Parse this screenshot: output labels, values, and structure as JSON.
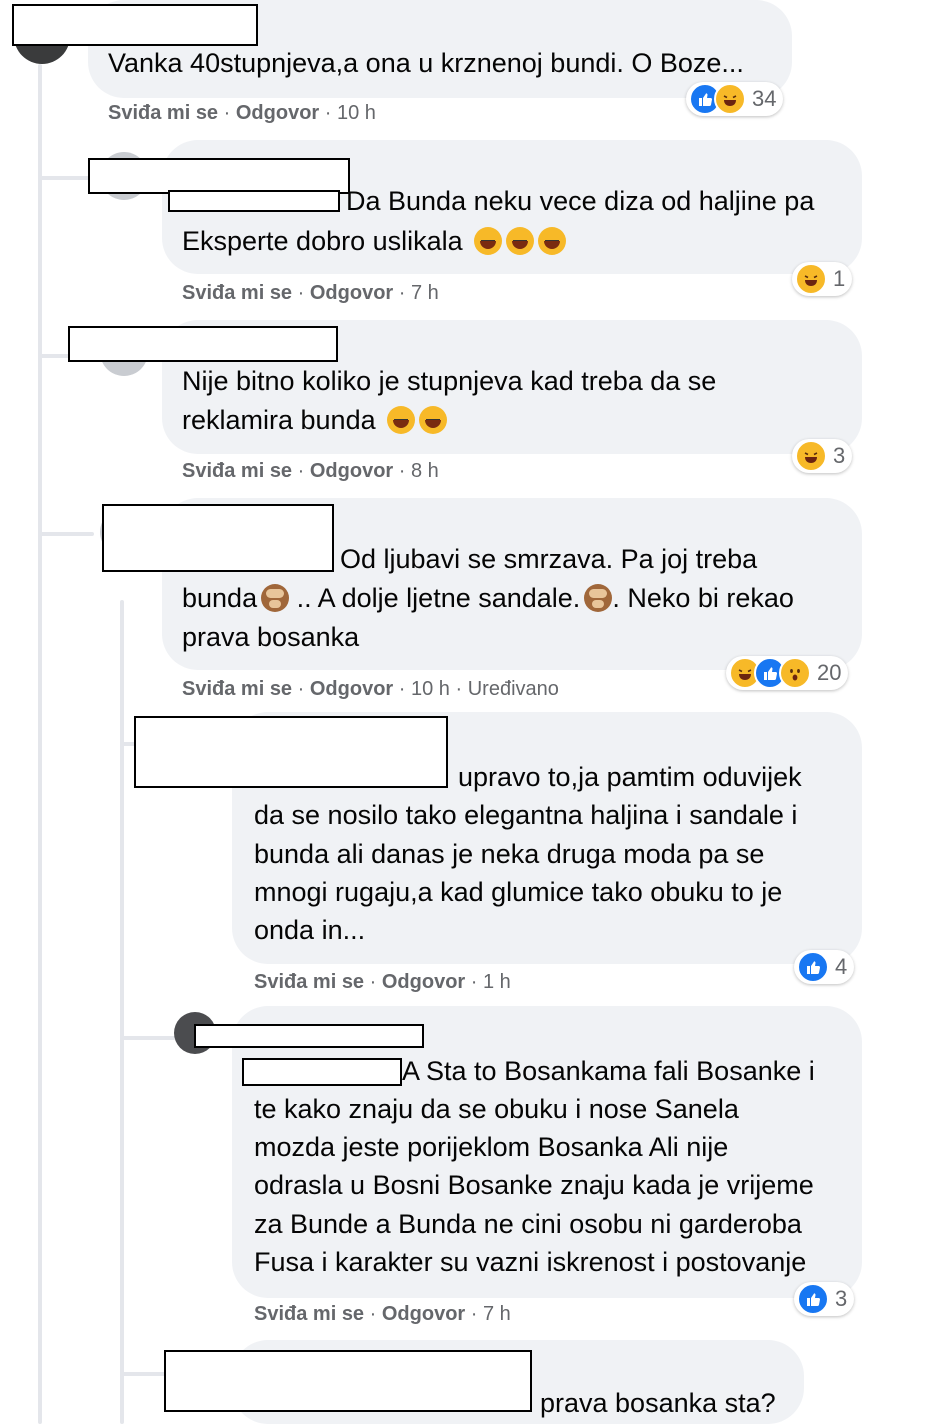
{
  "colors": {
    "bubble": "#f0f2f5",
    "meta": "#65676b",
    "like": "#1877f2",
    "haha": "#f7b928"
  },
  "comments": [
    {
      "text_lines": [
        "Vanka 40stupnjeva,a ona u krznenoj bundi. O Boze..."
      ],
      "like": "Sviđa mi se",
      "reply": "Odgovor",
      "time": "10 h",
      "reactions": [
        "like-icon",
        "haha-icon"
      ],
      "count": "34"
    },
    {
      "text_lines": [
        "Da Bunda neku vece diza od haljine pa",
        "Eksperte dobro uslikala"
      ],
      "emojis": [
        "crying-laughing-emoji",
        "crying-laughing-emoji",
        "crying-laughing-emoji"
      ],
      "like": "Sviđa mi se",
      "reply": "Odgovor",
      "time": "7 h",
      "reactions": [
        "haha-icon"
      ],
      "count": "1"
    },
    {
      "text_lines": [
        "Nije bitno koliko je stupnjeva kad treba da se",
        "reklamira bunda"
      ],
      "emojis": [
        "crying-laughing-emoji",
        "crying-laughing-emoji"
      ],
      "like": "Sviđa mi se",
      "reply": "Odgovor",
      "time": "8 h",
      "reactions": [
        "haha-icon"
      ],
      "count": "3"
    },
    {
      "text_lines": [
        "Od ljubavi se smrzava. Pa joj treba",
        "bunda",
        " .. A dolje ljetne sandale.",
        ". Neko bi rekao",
        "prava bosanka"
      ],
      "like": "Sviđa mi se",
      "reply": "Odgovor",
      "time": "10 h",
      "edited": "Uređivano",
      "reactions": [
        "haha-icon",
        "like-icon",
        "wow-icon"
      ],
      "count": "20"
    },
    {
      "text_lines": [
        "upravo to,ja pamtim oduvijek",
        "da se nosilo tako elegantna haljina i sandale i",
        "bunda ali danas je neka druga moda pa se",
        "mnogi rugaju,a kad glumice tako obuku to je",
        "onda in..."
      ],
      "like": "Sviđa mi se",
      "reply": "Odgovor",
      "time": "1 h",
      "reactions": [
        "like-icon"
      ],
      "count": "4"
    },
    {
      "text_lines": [
        "A Sta to Bosankama fali Bosanke i",
        "te kako znaju da se obuku i nose Sanela",
        "mozda jeste porijeklom Bosanka Ali nije",
        "odrasla u Bosni Bosanke znaju kada je vrijeme",
        "za Bunde a Bunda ne cini osobu ni garderoba",
        "Fusa i karakter su vazni iskrenost i postovanje"
      ],
      "like": "Sviđa mi se",
      "reply": "Odgovor",
      "time": "7 h",
      "reactions": [
        "like-icon"
      ],
      "count": "3"
    },
    {
      "text_lines": [
        "prava bosanka sta?"
      ]
    }
  ],
  "sep": "·"
}
